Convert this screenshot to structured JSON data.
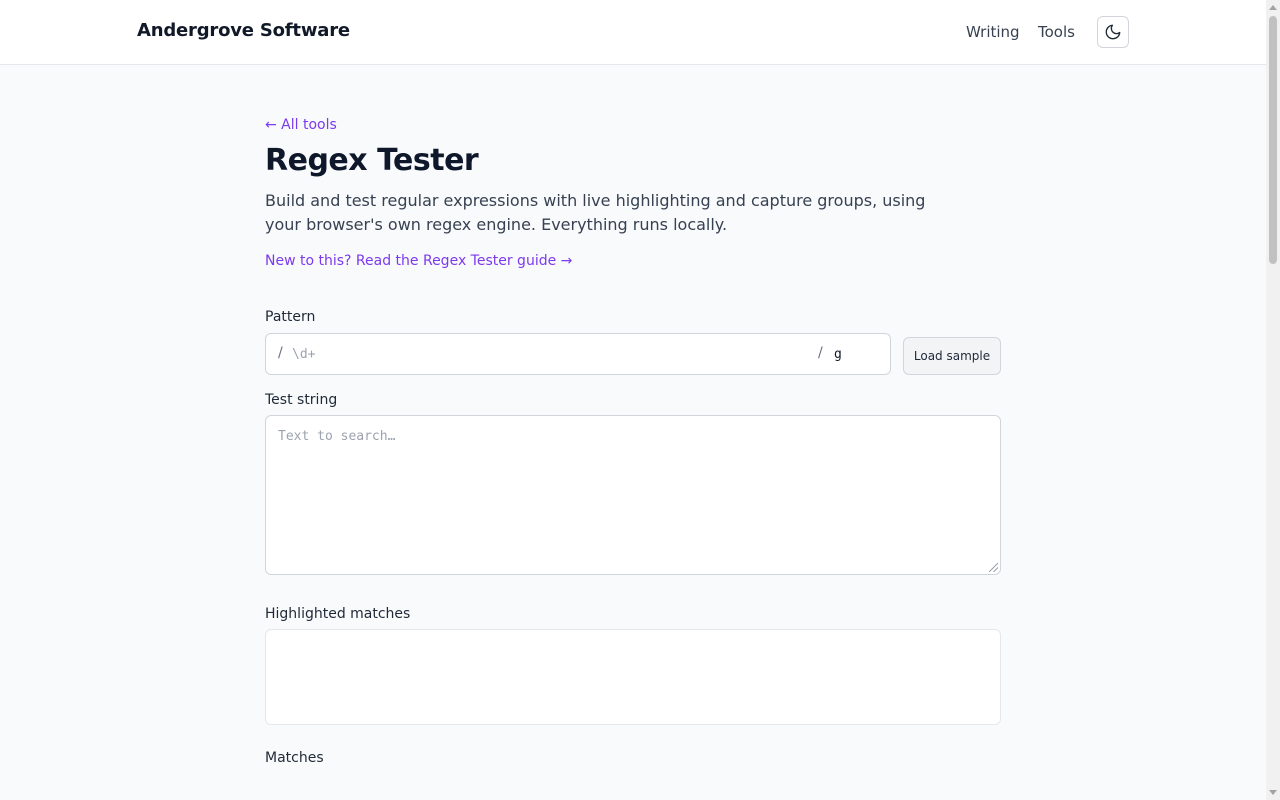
{
  "header": {
    "brand": "Andergrove Software",
    "nav": {
      "writing": "Writing",
      "tools": "Tools"
    },
    "theme_toggle_icon": "moon-icon"
  },
  "page": {
    "back_link": "← All tools",
    "title": "Regex Tester",
    "description": "Build and test regular expressions with live highlighting and capture groups, using your browser's own regex engine. Everything runs locally.",
    "guide_link": "New to this? Read the Regex Tester guide →"
  },
  "pattern": {
    "label": "Pattern",
    "slash": "/",
    "placeholder": "\\d+",
    "value": "",
    "flags": "g",
    "load_sample": "Load sample"
  },
  "test_string": {
    "label": "Test string",
    "placeholder": "Text to search…",
    "value": ""
  },
  "highlighted": {
    "label": "Highlighted matches"
  },
  "matches": {
    "label": "Matches"
  },
  "colors": {
    "accent": "#7c3aed",
    "background": "#f8fafc",
    "header_bg": "#ffffff"
  }
}
